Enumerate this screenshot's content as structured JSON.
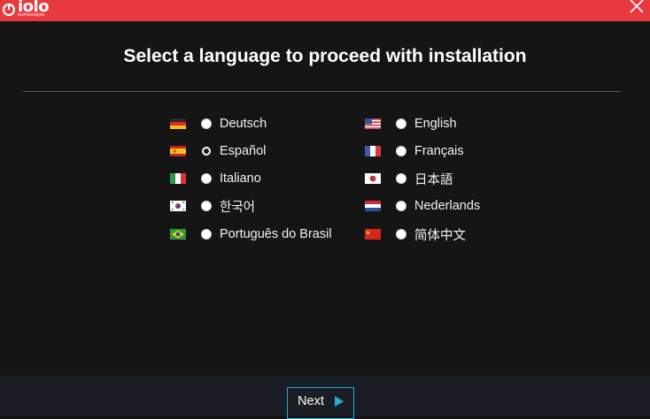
{
  "titlebar": {
    "logo_text": "iolo",
    "logo_subtext": "technologies",
    "close_icon": "close-icon",
    "accent_color": "#e8393f"
  },
  "heading": "Select a language to proceed with installation",
  "languages": [
    {
      "label": "Deutsch",
      "flag": "flag-germany-icon",
      "checked": false
    },
    {
      "label": "English",
      "flag": "flag-usa-icon",
      "checked": false
    },
    {
      "label": "Español",
      "flag": "flag-spain-icon",
      "checked": true
    },
    {
      "label": "Français",
      "flag": "flag-france-icon",
      "checked": false
    },
    {
      "label": "Italiano",
      "flag": "flag-italy-icon",
      "checked": false
    },
    {
      "label": "日本語",
      "flag": "flag-japan-icon",
      "checked": false
    },
    {
      "label": "한국어",
      "flag": "flag-korea-icon",
      "checked": false
    },
    {
      "label": "Nederlands",
      "flag": "flag-netherlands-icon",
      "checked": false
    },
    {
      "label": "Português do Brasil",
      "flag": "flag-brazil-icon",
      "checked": false
    },
    {
      "label": "简体中文",
      "flag": "flag-china-icon",
      "checked": false
    }
  ],
  "footer": {
    "next_label": "Next",
    "next_icon": "play-arrow-icon",
    "button_border_color": "#2aa8d8"
  }
}
